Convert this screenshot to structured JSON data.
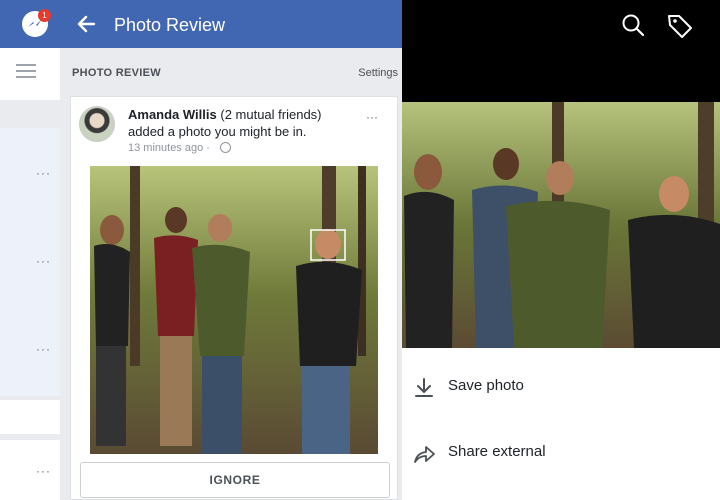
{
  "left": {
    "messenger_badge": "1",
    "items": [
      {
        "more": "···"
      },
      {
        "more": "···"
      },
      {
        "more": "···"
      },
      {
        "more": "···"
      }
    ]
  },
  "header": {
    "title": "Photo Review"
  },
  "section": {
    "title": "PHOTO REVIEW",
    "settings": "Settings"
  },
  "post": {
    "author": "Amanda Willis",
    "mutual": "(2 mutual friends)",
    "text": "added a photo you might be in.",
    "time": "13 minutes ago ·",
    "more": "···",
    "ignore_label": "IGNORE"
  },
  "viewer": {
    "actions": [
      {
        "label": "Save photo",
        "icon": "download-icon"
      },
      {
        "label": "Share external",
        "icon": "share-icon"
      }
    ]
  },
  "colors": {
    "brand_blue": "#4267b2",
    "panel_bg": "#e9ebee",
    "text_dark": "#1d2129",
    "muted": "#90949c"
  }
}
